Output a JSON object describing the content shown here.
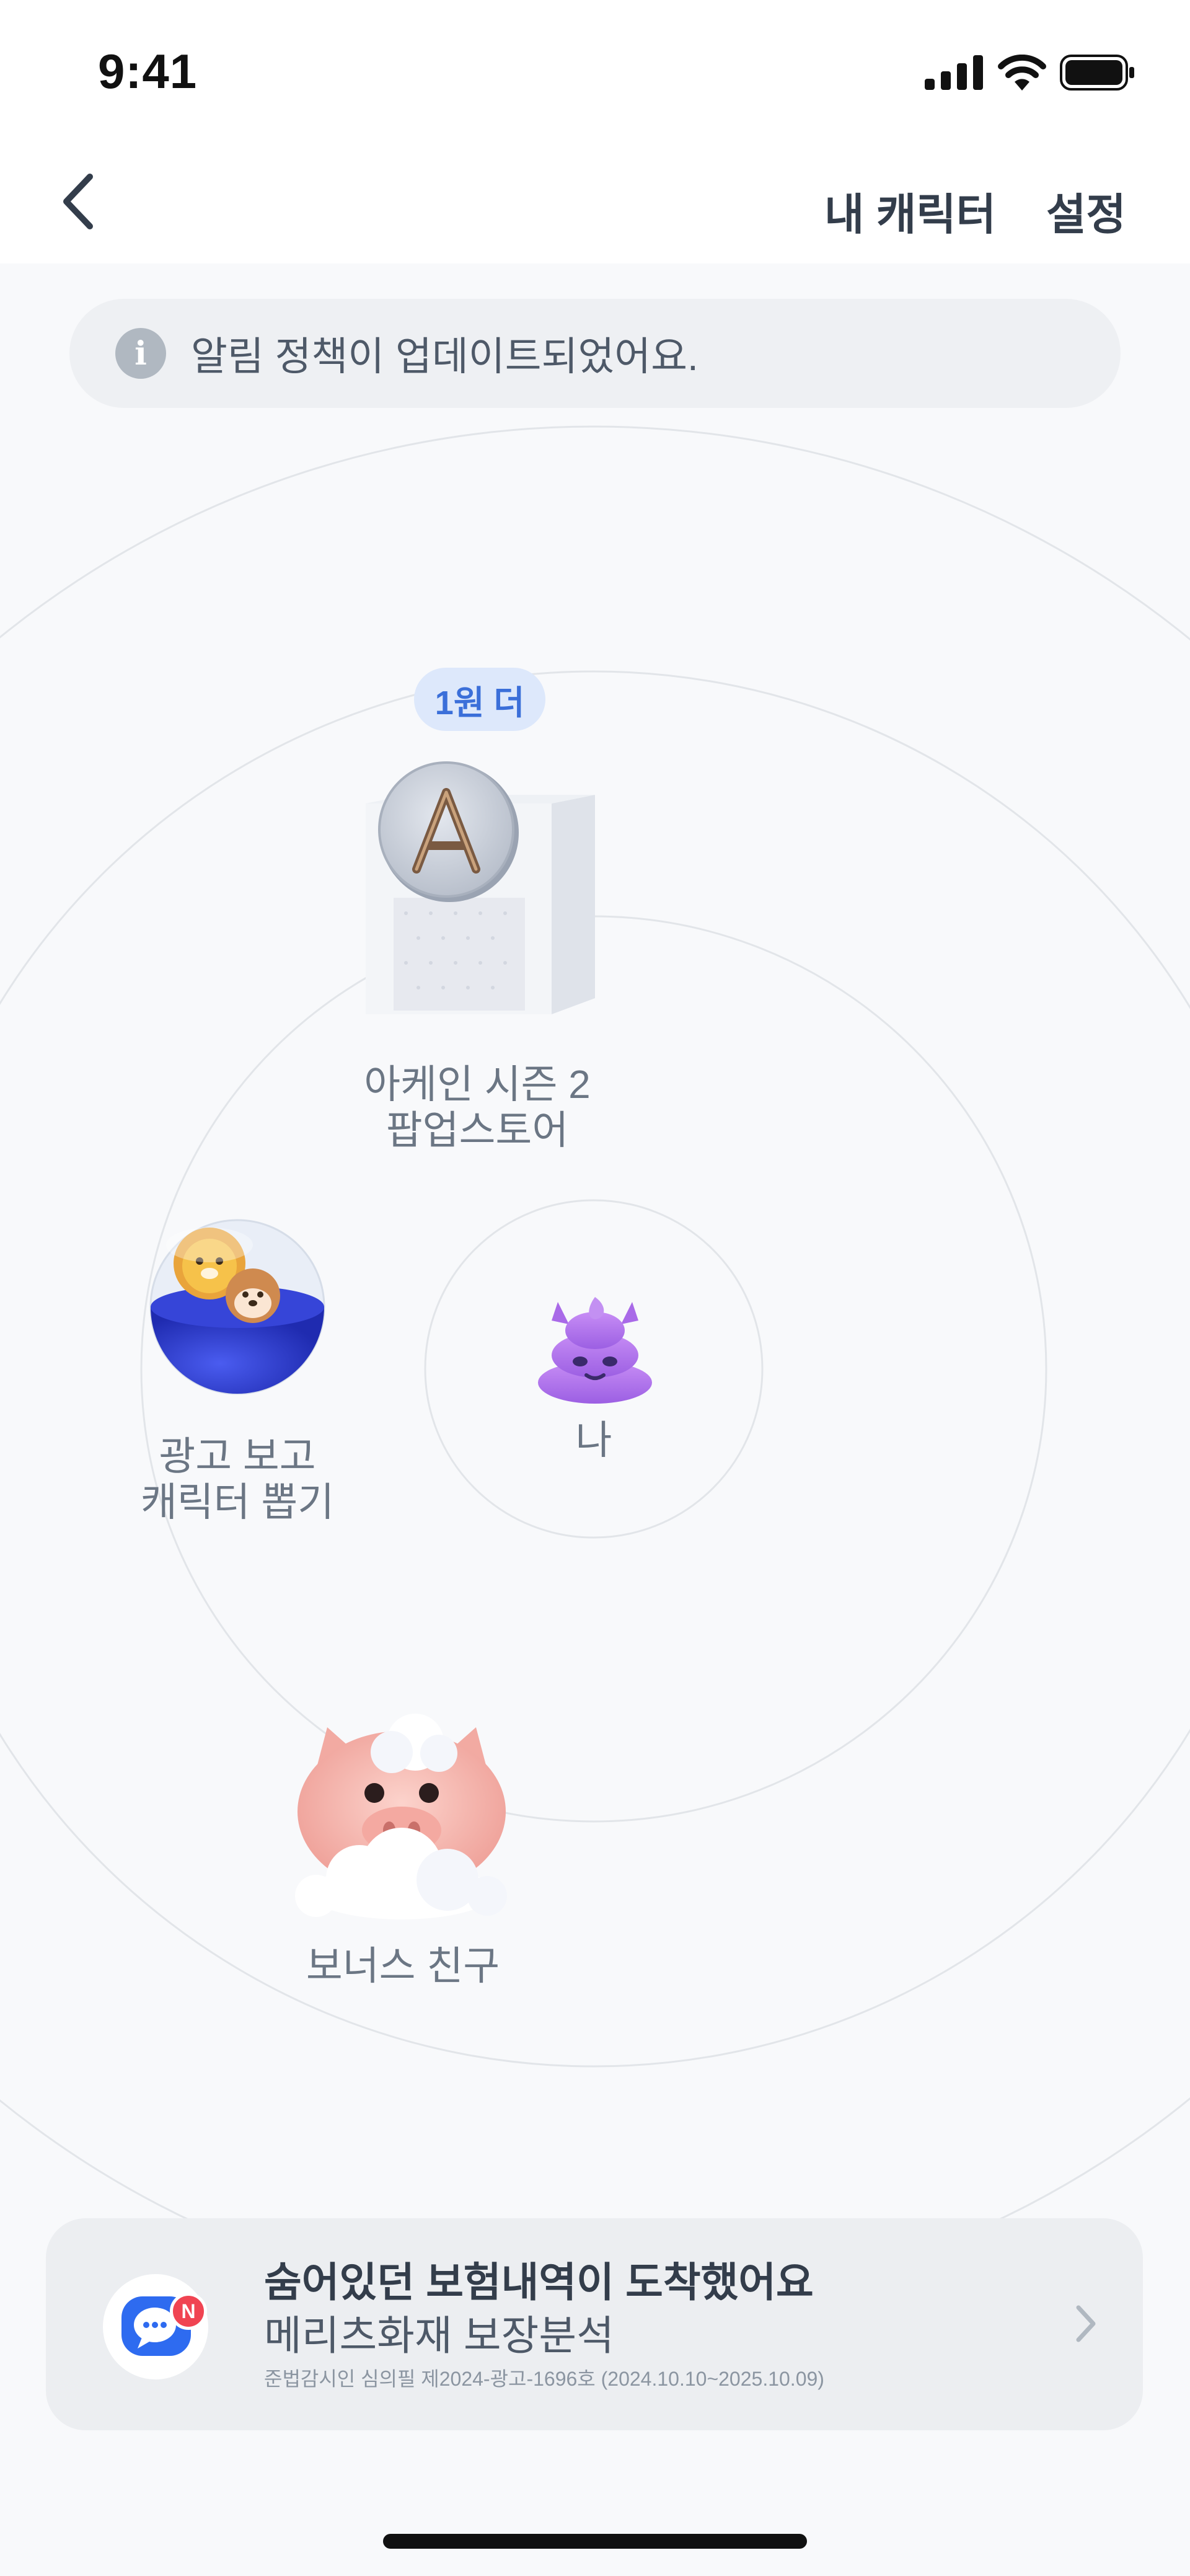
{
  "status_bar": {
    "time": "9:41"
  },
  "nav": {
    "my_character": "내 캐릭터",
    "settings": "설정"
  },
  "notice": {
    "icon": "info-icon",
    "icon_glyph": "i",
    "text": "알림 정책이 업데이트되었어요."
  },
  "characters": {
    "popup": {
      "badge": "1원 더",
      "label_line1": "아케인 시즌 2",
      "label_line2": "팝업스토어",
      "logo_letter": "A"
    },
    "me": {
      "label": "나"
    },
    "gacha": {
      "label_line1": "광고 보고",
      "label_line2": "캐릭터 뽑기"
    },
    "bonus": {
      "label": "보너스 친구"
    }
  },
  "banner": {
    "title": "숨어있던 보험내역이 도착했어요",
    "subtitle": "메리츠화재 보장분석",
    "legal": "준법감시인 심의필 제2024-광고-1696호 (2024.10.10~2025.10.09)",
    "badge": "N"
  },
  "colors": {
    "background": "#f8f9fb",
    "accent_blue": "#3b6fd9",
    "badge_red": "#f04452",
    "text_primary": "#333d4b",
    "text_secondary": "#6b7684"
  }
}
